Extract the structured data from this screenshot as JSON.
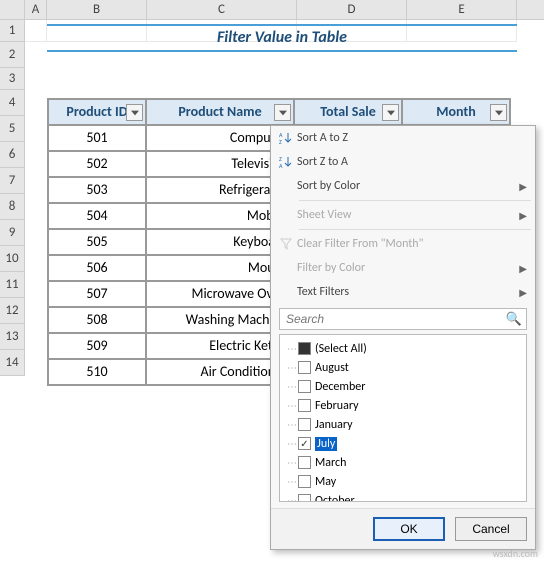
{
  "columns": [
    "A",
    "B",
    "C",
    "D",
    "E"
  ],
  "row_numbers": [
    1,
    2,
    3,
    4,
    5,
    6,
    7,
    8,
    9,
    10,
    11,
    12,
    13,
    14
  ],
  "title": "Filter Value in Table",
  "table": {
    "headers": [
      "Product ID",
      "Product Name",
      "Total Sale",
      "Month"
    ],
    "rows": [
      {
        "id": "501",
        "name": "Computer"
      },
      {
        "id": "502",
        "name": "Television"
      },
      {
        "id": "503",
        "name": "Refrigerator"
      },
      {
        "id": "504",
        "name": "Mobile"
      },
      {
        "id": "505",
        "name": "Keyboard"
      },
      {
        "id": "506",
        "name": "Mouse"
      },
      {
        "id": "507",
        "name": "Microwave Oven"
      },
      {
        "id": "508",
        "name": "Washing Machine"
      },
      {
        "id": "509",
        "name": "Electric Kettle"
      },
      {
        "id": "510",
        "name": "Air Conditioner"
      }
    ]
  },
  "menu": {
    "sort_az": "Sort A to Z",
    "sort_za": "Sort Z to A",
    "sort_color": "Sort by Color",
    "sheet_view": "Sheet View",
    "clear_filter": "Clear Filter From \"Month\"",
    "filter_color": "Filter by Color",
    "text_filters": "Text Filters",
    "search_placeholder": "Search",
    "items": [
      {
        "label": "(Select All)",
        "checked": "filled"
      },
      {
        "label": "August",
        "checked": false
      },
      {
        "label": "December",
        "checked": false
      },
      {
        "label": "February",
        "checked": false
      },
      {
        "label": "January",
        "checked": false
      },
      {
        "label": "July",
        "checked": true,
        "highlight": true
      },
      {
        "label": "March",
        "checked": false
      },
      {
        "label": "May",
        "checked": false
      },
      {
        "label": "October",
        "checked": false
      }
    ],
    "ok": "OK",
    "cancel": "Cancel"
  },
  "watermark": "wsxdn.com"
}
